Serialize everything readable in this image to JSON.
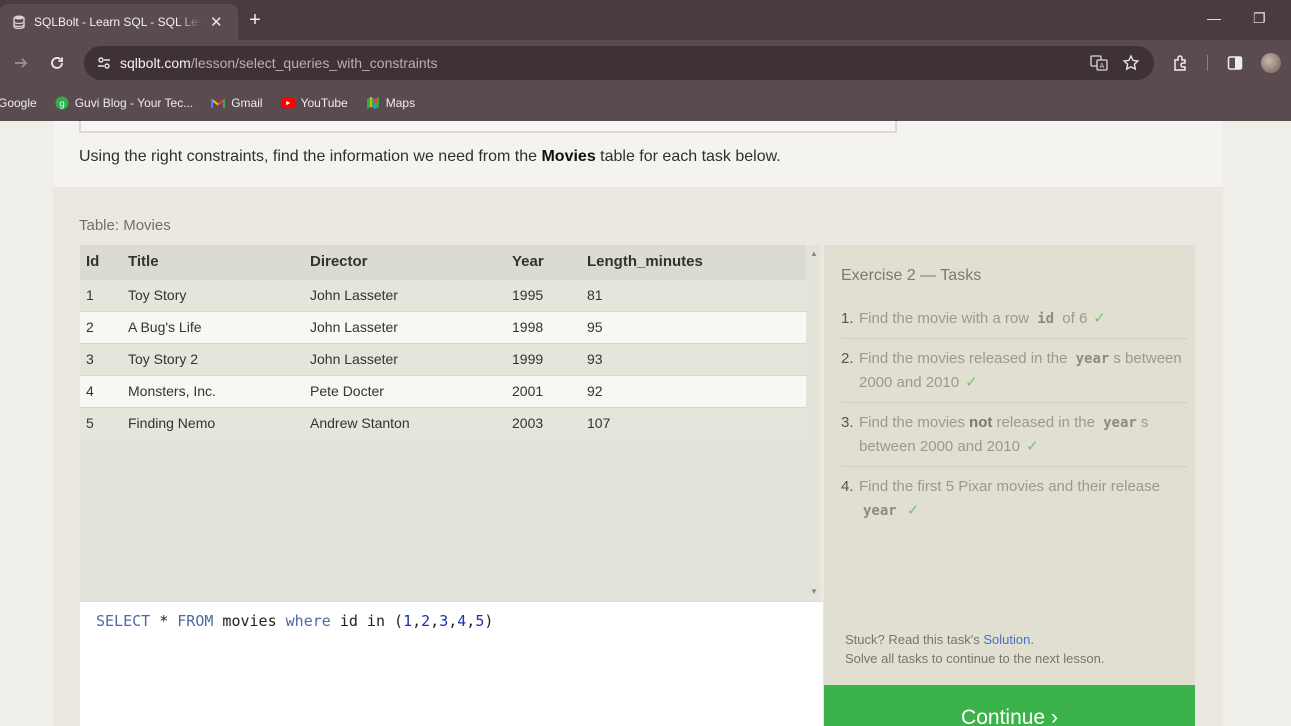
{
  "browser": {
    "tab_title": "SQLBolt - Learn SQL - SQL Less",
    "tab_close": "✕",
    "new_tab": "+",
    "url_host": "sqlbolt.com",
    "url_path": "/lesson/select_queries_with_constraints",
    "window_minimize": "—",
    "window_restore": "❐",
    "bookmarks": [
      {
        "label": "Google",
        "icon": "google-icon"
      },
      {
        "label": "Guvi Blog - Your Tec...",
        "icon": "guvi-icon"
      },
      {
        "label": "Gmail",
        "icon": "gmail-icon"
      },
      {
        "label": "YouTube",
        "icon": "youtube-icon"
      },
      {
        "label": "Maps",
        "icon": "maps-icon"
      }
    ],
    "colors": {
      "chrome": "#594b50",
      "tabstrip": "#4a3b40"
    }
  },
  "lesson": {
    "intro_before": "Using the right constraints, find the information we need from the ",
    "intro_bold": "Movies",
    "intro_after": " table for each task below.",
    "table_caption": "Table: Movies",
    "table": {
      "headers": [
        "Id",
        "Title",
        "Director",
        "Year",
        "Length_minutes"
      ],
      "rows": [
        [
          "1",
          "Toy Story",
          "John Lasseter",
          "1995",
          "81"
        ],
        [
          "2",
          "A Bug's Life",
          "John Lasseter",
          "1998",
          "95"
        ],
        [
          "3",
          "Toy Story 2",
          "John Lasseter",
          "1999",
          "93"
        ],
        [
          "4",
          "Monsters, Inc.",
          "Pete Docter",
          "2001",
          "92"
        ],
        [
          "5",
          "Finding Nemo",
          "Andrew Stanton",
          "2003",
          "107"
        ]
      ]
    },
    "query": {
      "kw_select": "SELECT",
      "star": " * ",
      "kw_from": "FROM",
      "table": " movies ",
      "kw_where": "where",
      "cond": " id in (",
      "n1": "1",
      "n2": "2",
      "n3": "3",
      "n4": "4",
      "n5": "5",
      "close": ")",
      "comma": ","
    }
  },
  "tasks": {
    "title": "Exercise 2 — Tasks",
    "items": [
      {
        "num": "1.",
        "a": "Find the movie with a row ",
        "code": "id",
        "b": " of 6"
      },
      {
        "num": "2.",
        "a": "Find the movies released in the ",
        "code": "year",
        "b": "s between 2000 and 2010"
      },
      {
        "num": "3.",
        "a": "Find the movies ",
        "bold": "not",
        "a2": " released in the ",
        "code": "year",
        "b": "s between 2000 and 2010"
      },
      {
        "num": "4.",
        "a": "Find the first 5 Pixar movies and their release ",
        "code": "year",
        "b": ""
      }
    ],
    "check": "✓",
    "stuck_text": "Stuck? Read this task's ",
    "solution_link": "Solution",
    "stuck_end": ".",
    "solve_all": "Solve all tasks to continue to the next lesson."
  },
  "continue_label": "Continue ›",
  "accent_color": "#3cb34a"
}
